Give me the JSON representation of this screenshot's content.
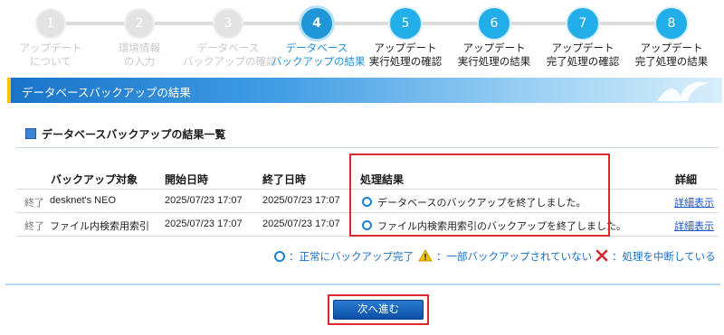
{
  "stepper": {
    "steps": [
      {
        "num": "1",
        "line1": "アップデート",
        "line2": "について",
        "state": "done"
      },
      {
        "num": "2",
        "line1": "環境情報",
        "line2": "の入力",
        "state": "done"
      },
      {
        "num": "3",
        "line1": "データベース",
        "line2": "バックアップの確認",
        "state": "done"
      },
      {
        "num": "4",
        "line1": "データベース",
        "line2": "バックアップの結果",
        "state": "current"
      },
      {
        "num": "5",
        "line1": "アップデート",
        "line2": "実行処理の確認",
        "state": "todo"
      },
      {
        "num": "6",
        "line1": "アップデート",
        "line2": "実行処理の結果",
        "state": "todo"
      },
      {
        "num": "7",
        "line1": "アップデート",
        "line2": "完了処理の確認",
        "state": "todo"
      },
      {
        "num": "8",
        "line1": "アップデート",
        "line2": "完了処理の結果",
        "state": "todo"
      }
    ]
  },
  "header": {
    "title": "データベースバックアップの結果"
  },
  "section": {
    "title": "データベースバックアップの結果一覧"
  },
  "table": {
    "headers": {
      "target": "バックアップ対象",
      "start": "開始日時",
      "end": "終了日時",
      "result": "処理結果",
      "detail": "詳細"
    },
    "rows": [
      {
        "status": "終了",
        "target": "desknet's NEO",
        "start": "2025/07/23 17:07",
        "end": "2025/07/23 17:07",
        "result": "データベースのバックアップを終了しました。",
        "detail": "詳細表示"
      },
      {
        "status": "終了",
        "target": "ファイル内検索用索引",
        "start": "2025/07/23 17:07",
        "end": "2025/07/23 17:07",
        "result": "ファイル内検索用索引のバックアップを終了しました。",
        "detail": "詳細表示"
      }
    ]
  },
  "legend": {
    "ok": "：正常にバックアップ完了",
    "partial": "：一部バックアップされていない",
    "aborted": "：処理を中断している"
  },
  "footer": {
    "next_label": "次へ進む"
  },
  "colors": {
    "accent": "#1e96d8",
    "highlight": "#e0262e",
    "warning": "#f2c200",
    "error": "#d9232d"
  }
}
